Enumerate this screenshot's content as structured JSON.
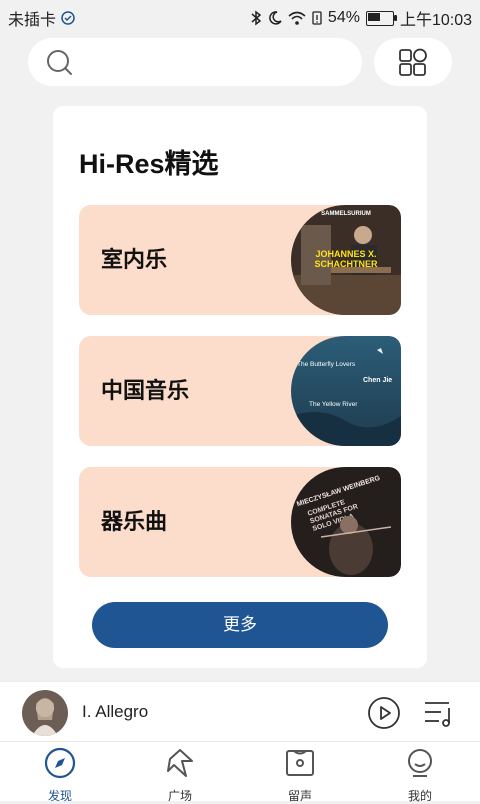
{
  "status_bar": {
    "carrier": "未插卡",
    "battery": "54%",
    "battery_level": 0.54,
    "time": "上午10:03"
  },
  "search": {
    "placeholder": ""
  },
  "card": {
    "title": "Hi-Res精选",
    "categories": [
      {
        "label": "室内乐",
        "cover_top": "SAMMELSURIUM",
        "cover_mid": "JOHANNES X. SCHACHTNER"
      },
      {
        "label": "中国音乐",
        "cover_top": "The Butterfly Lovers",
        "cover_mid": "Chen Jie",
        "cover_bottom": "The Yellow River"
      },
      {
        "label": "器乐曲",
        "cover_top": "MIECZYSŁAW WEINBERG",
        "cover_mid": "COMPLETE SONATAS FOR SOLO VIOLA"
      }
    ],
    "more_label": "更多"
  },
  "player": {
    "track": "I. Allegro"
  },
  "tabs": [
    {
      "label": "发现",
      "icon": "compass-icon",
      "active": true
    },
    {
      "label": "广场",
      "icon": "plaza-icon",
      "active": false
    },
    {
      "label": "留声",
      "icon": "record-icon",
      "active": false
    },
    {
      "label": "我的",
      "icon": "profile-icon",
      "active": false
    }
  ],
  "colors": {
    "accent": "#1f5592",
    "category_bg": "#fcdcca",
    "background": "#f1f1f1"
  }
}
